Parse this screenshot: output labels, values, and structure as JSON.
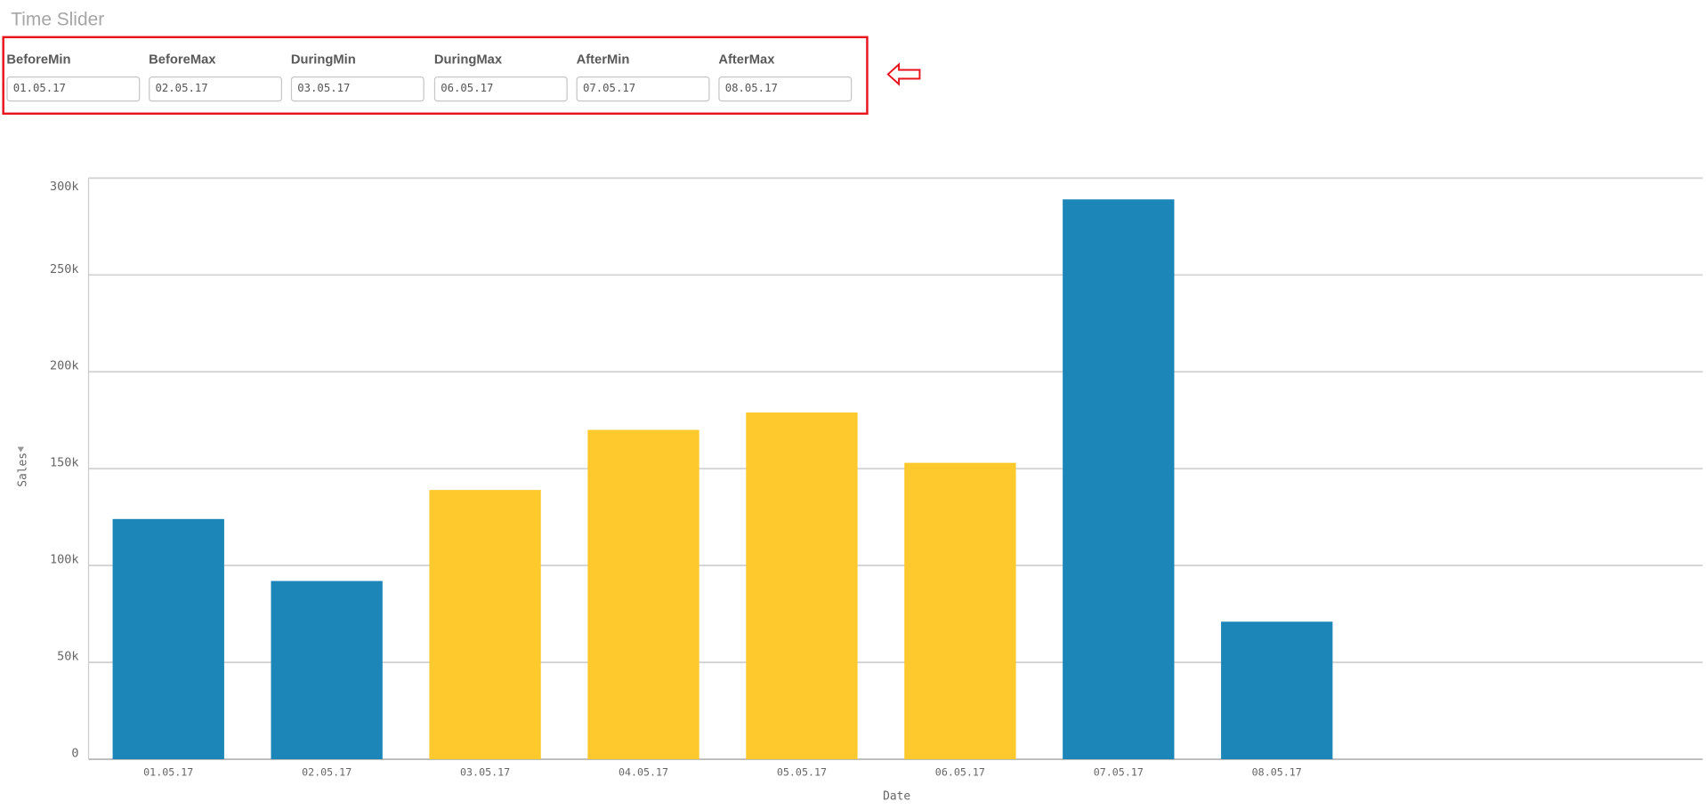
{
  "title": "Time Slider",
  "fields": [
    {
      "label": "BeforeMin",
      "value": "01.05.17"
    },
    {
      "label": "BeforeMax",
      "value": "02.05.17"
    },
    {
      "label": "DuringMin",
      "value": "03.05.17"
    },
    {
      "label": "DuringMax",
      "value": "06.05.17"
    },
    {
      "label": "AfterMin",
      "value": "07.05.17"
    },
    {
      "label": "AfterMax",
      "value": "08.05.17"
    }
  ],
  "colors": {
    "outside": "#1c86b8",
    "during": "#fec92d",
    "highlight": "#e8141e"
  },
  "chart_data": {
    "type": "bar",
    "title": "",
    "xlabel": "Date",
    "ylabel": "Sales",
    "ylim": [
      0,
      300000
    ],
    "yticks": [
      {
        "v": 0,
        "label": "0"
      },
      {
        "v": 50000,
        "label": "50k"
      },
      {
        "v": 100000,
        "label": "100k"
      },
      {
        "v": 150000,
        "label": "150k"
      },
      {
        "v": 200000,
        "label": "200k"
      },
      {
        "v": 250000,
        "label": "250k"
      },
      {
        "v": 300000,
        "label": "300k"
      }
    ],
    "categories": [
      "01.05.17",
      "02.05.17",
      "03.05.17",
      "04.05.17",
      "05.05.17",
      "06.05.17",
      "07.05.17",
      "08.05.17"
    ],
    "values": [
      124000,
      92000,
      139000,
      170000,
      179000,
      153000,
      289000,
      71000
    ],
    "period": [
      "outside",
      "outside",
      "during",
      "during",
      "during",
      "during",
      "outside",
      "outside"
    ],
    "grid": true
  }
}
